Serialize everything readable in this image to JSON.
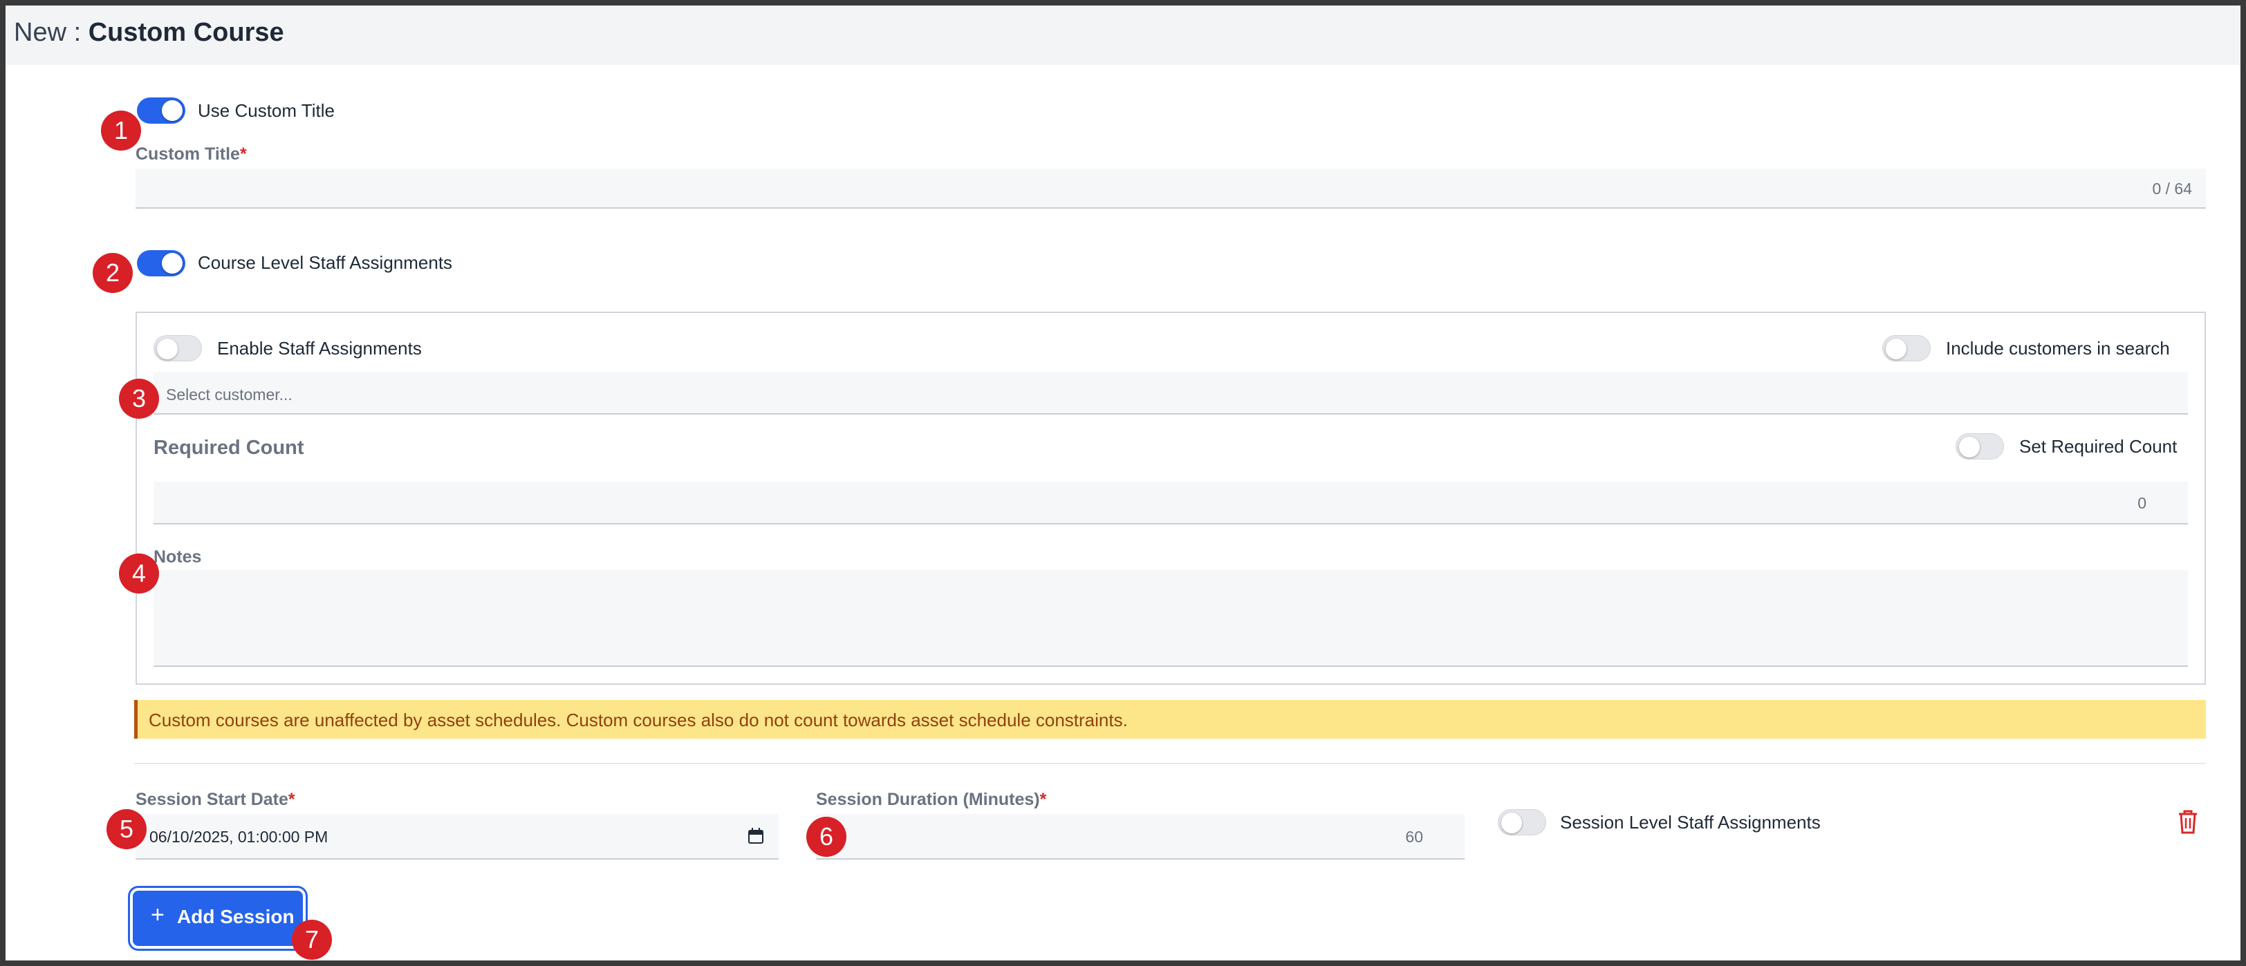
{
  "header": {
    "prefix": "New : ",
    "title": "Custom Course"
  },
  "custom_title": {
    "toggle_label": "Use Custom Title",
    "toggle_on": true,
    "field_label": "Custom Title",
    "required_mark": "*",
    "value": "",
    "char_count": "0 / 64"
  },
  "course_staff": {
    "toggle_label": "Course Level Staff Assignments",
    "toggle_on": true
  },
  "staff_panel": {
    "enable_label": "Enable Staff Assignments",
    "enable_on": false,
    "include_customers_label": "Include customers in search",
    "include_customers_on": false,
    "customer_placeholder": "Select customer...",
    "required_count_label": "Required Count",
    "set_required_label": "Set Required Count",
    "set_required_on": false,
    "required_count_value": "0",
    "notes_label": "Notes",
    "notes_value": ""
  },
  "warning": {
    "text": "Custom courses are unaffected by asset schedules. Custom courses also do not count towards asset schedule constraints.",
    "bg_color": "#fde68a",
    "text_color": "#92400e"
  },
  "session": {
    "start_label": "Session Start Date",
    "start_required": "*",
    "start_value": "06/10/2025, 01:00:00 PM",
    "duration_label": "Session Duration (Minutes)",
    "duration_required": "*",
    "duration_value": "60",
    "staff_label": "Session Level Staff Assignments",
    "staff_on": false,
    "delete_icon": "trash-icon"
  },
  "add_session": {
    "plus": "+",
    "label": "Add Session",
    "color": "#2563eb"
  },
  "badges": [
    "1",
    "2",
    "3",
    "4",
    "5",
    "6",
    "7"
  ],
  "colors": {
    "accent": "#2563eb",
    "required": "#dc2626",
    "badge": "#d82027"
  }
}
